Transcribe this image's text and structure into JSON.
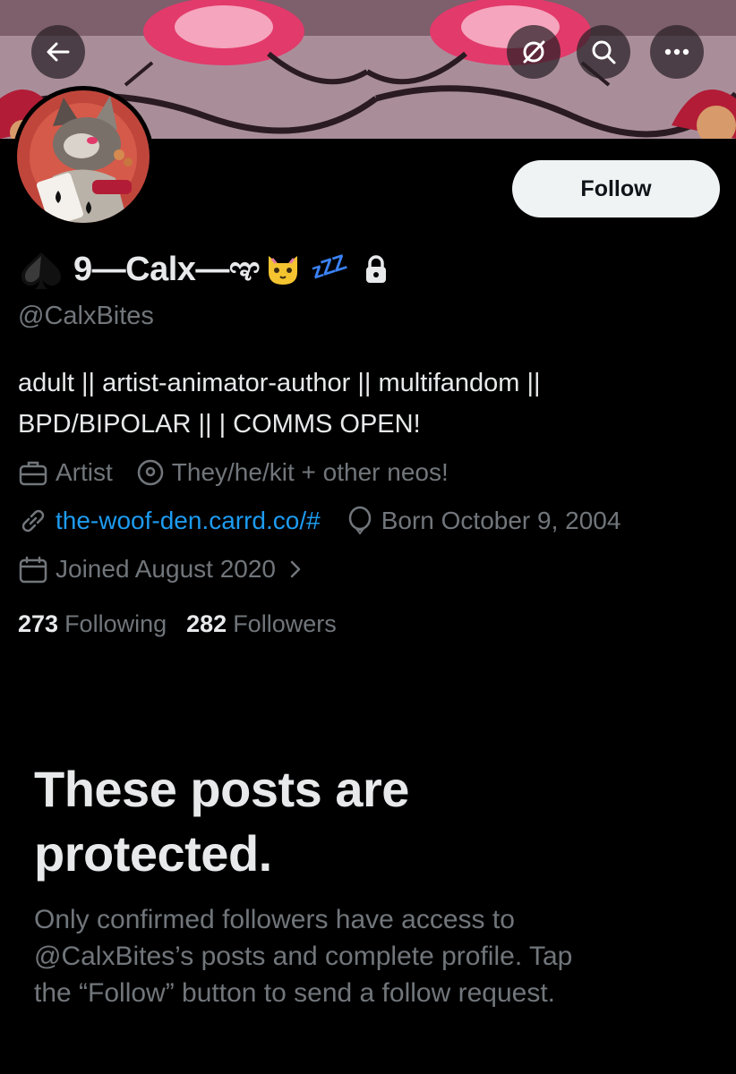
{
  "header": {
    "icons": [
      "back-arrow-icon",
      "meta-ai-icon",
      "search-icon",
      "more-icon"
    ]
  },
  "profile": {
    "follow_label": "Follow",
    "display_name": "9—Calx—ಞ",
    "emoji_suffix": [
      "cat-face",
      "zzz",
      "lock"
    ],
    "zzz_text": "zZZ",
    "handle": "@CalxBites",
    "bio_line1": "adult || artist-animator-author || multifandom ||",
    "bio_line2": "BPD/BIPOLAR || | COMMS OPEN!",
    "category": "Artist",
    "location": "They/he/kit + other neos!",
    "website": "the-woof-den.carrd.co/#",
    "birthday": "Born October 9, 2004",
    "joined": "Joined August 2020",
    "following_count": "273",
    "following_label": "Following",
    "followers_count": "282",
    "followers_label": "Followers"
  },
  "protected": {
    "title_line1": "These posts are",
    "title_line2": "protected.",
    "desc_line1": "Only confirmed followers have access to",
    "desc_line2": "@CalxBites’s posts and complete profile. Tap",
    "desc_line3": "the “Follow” button to send a follow request."
  },
  "colors": {
    "background": "#000000",
    "text": "#e7e9ea",
    "secondary": "#71767b",
    "link": "#1d9bf0",
    "follow_bg": "#eff3f4",
    "zzz": "#3b82f6"
  }
}
